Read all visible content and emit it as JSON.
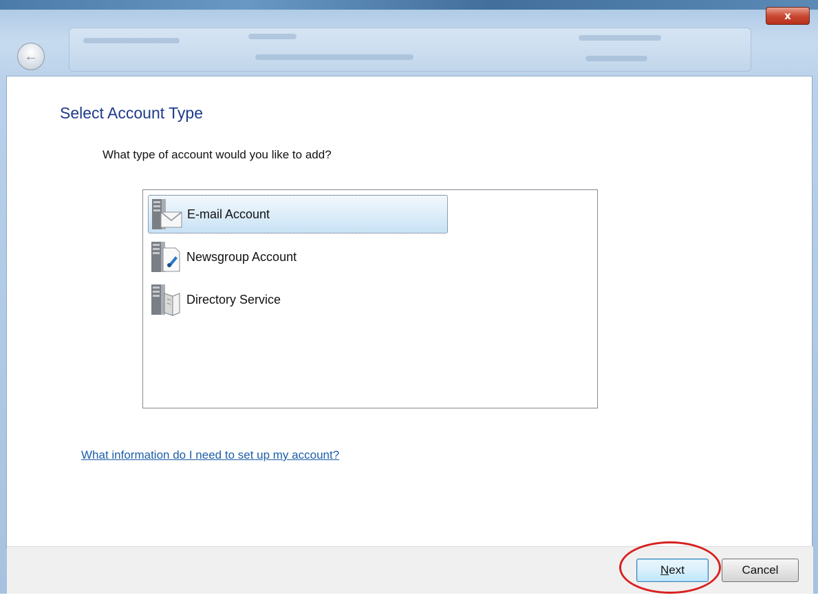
{
  "window": {
    "close_glyph": "x",
    "back_glyph": "←",
    "accent_color": "#1e3a8a"
  },
  "dialog": {
    "title": "Select Account Type",
    "question": "What type of account would you like to add?",
    "account_types": [
      {
        "label": "E-mail Account",
        "icon": "email-account-icon",
        "selected": true
      },
      {
        "label": "Newsgroup Account",
        "icon": "newsgroup-account-icon",
        "selected": false
      },
      {
        "label": "Directory Service",
        "icon": "directory-service-icon",
        "selected": false
      }
    ],
    "help_link": "What information do I need to set up my account?"
  },
  "buttons": {
    "next_mnemonic": "N",
    "next_rest": "ext",
    "cancel": "Cancel"
  },
  "annotation": {
    "ring_color": "#d8211f"
  }
}
